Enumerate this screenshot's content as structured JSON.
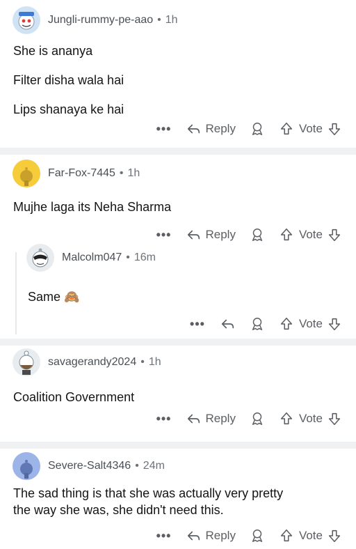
{
  "comments": [
    {
      "username": "Jungli-rummy-pe-aao",
      "separator": "•",
      "time": "1h",
      "lines": [
        "She is ananya",
        "Filter disha wala hai",
        "Lips shanaya ke hai"
      ],
      "reply_label": "Reply",
      "vote_label": "Vote",
      "more_label": "•••"
    },
    {
      "username": "Far-Fox-7445",
      "separator": "•",
      "time": "1h",
      "lines": [
        "Mujhe laga its Neha Sharma"
      ],
      "reply_label": "Reply",
      "vote_label": "Vote",
      "more_label": "•••"
    },
    {
      "username": "Malcolm047",
      "separator": "•",
      "time": "16m",
      "lines": [
        "Same 🙈"
      ],
      "vote_label": "Vote",
      "more_label": "•••"
    },
    {
      "username": "savagerandy2024",
      "separator": "•",
      "time": "1h",
      "lines": [
        "Coalition Government"
      ],
      "reply_label": "Reply",
      "vote_label": "Vote",
      "more_label": "•••"
    },
    {
      "username": "Severe-Salt4346",
      "separator": "•",
      "time": "24m",
      "lines": [
        "The sad thing is that she was actually very pretty",
        "the way she was, she didn't need this."
      ],
      "reply_label": "Reply",
      "vote_label": "Vote",
      "more_label": "•••"
    }
  ],
  "colors": {
    "divider": "#f0f1f2",
    "icon_gray": "#5b5f63",
    "avatar_blue": "#cfe3f5",
    "avatar_yellow": "#f7cc3b",
    "avatar_gray": "#e8ecef",
    "avatar_periwinkle": "#9db4e8"
  },
  "icons": [
    "reply-arrow-icon",
    "award-icon",
    "upvote-arrow-icon",
    "downvote-arrow-icon",
    "more-dots-icon"
  ]
}
